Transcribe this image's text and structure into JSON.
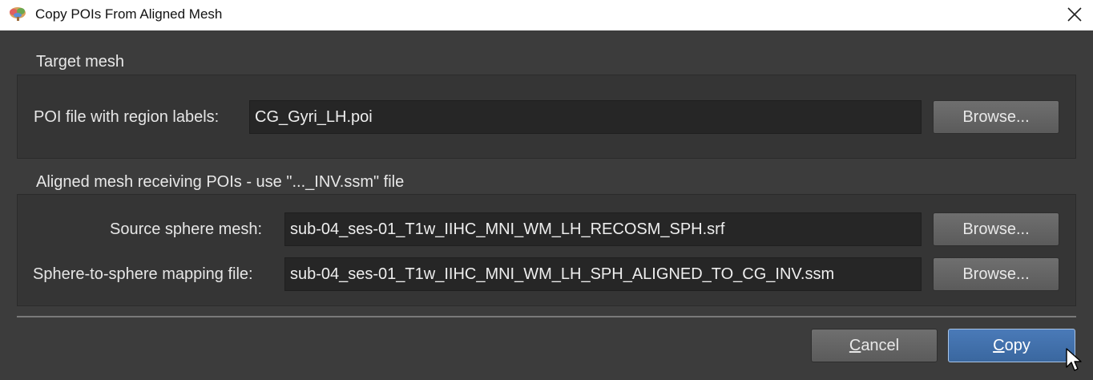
{
  "window": {
    "title": "Copy POIs From Aligned Mesh",
    "app_icon": "brain-icon",
    "close_icon": "close-icon"
  },
  "target_section": {
    "title": "Target mesh",
    "poi_label": "POI file with region labels:",
    "poi_value": "CG_Gyri_LH.poi",
    "browse_label": "Browse..."
  },
  "aligned_section": {
    "title": "Aligned mesh receiving POIs - use \"..._INV.ssm\" file",
    "source_label": "Source sphere mesh:",
    "source_value": "sub-04_ses-01_T1w_IIHC_MNI_WM_LH_RECOSM_SPH.srf",
    "source_browse_label": "Browse...",
    "mapping_label": "Sphere-to-sphere mapping file:",
    "mapping_value": "sub-04_ses-01_T1w_IIHC_MNI_WM_LH_SPH_ALIGNED_TO_CG_INV.ssm",
    "mapping_browse_label": "Browse..."
  },
  "footer": {
    "cancel_first": "C",
    "cancel_rest": "ancel",
    "copy_first": "C",
    "copy_rest": "opy"
  },
  "colors": {
    "background": "#3c3c3c",
    "panel": "#353535",
    "field": "#262626",
    "primary_button": "#3f6fab"
  }
}
